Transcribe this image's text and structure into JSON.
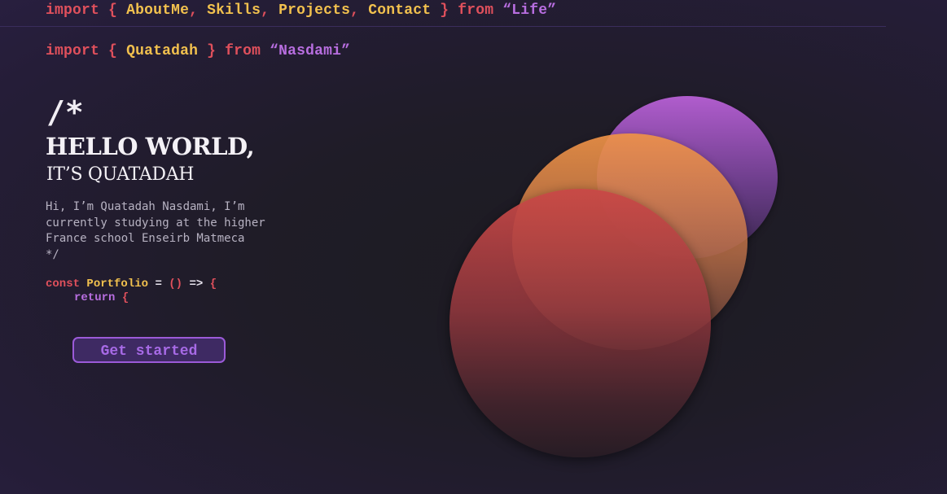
{
  "nav": {
    "keyword_import": "import",
    "brace_open": "{",
    "links": [
      "AboutMe",
      "Skills",
      "Projects",
      "Contact"
    ],
    "comma": ",",
    "brace_close": "}",
    "keyword_from": "from",
    "source": "“Life”"
  },
  "import_name": {
    "keyword_import": "import",
    "brace_open": "{",
    "name": "Quatadah",
    "brace_close": "}",
    "keyword_from": "from",
    "source": "“Nasdami”"
  },
  "hero": {
    "comment_open": "/*",
    "greeting": "HELLO WORLD,",
    "intro": "IT’S QUATADAH",
    "bio_line1": "Hi, I’m Quatadah Nasdami,  I’m",
    "bio_line2": "currently studying  at the higher",
    "bio_line3": "France school Enseirb Matmeca",
    "comment_close": "*/"
  },
  "code": {
    "const_kw": "const",
    "component": "Portfolio",
    "equals": "=",
    "parens": "()",
    "arrow": "=>",
    "brace": "{",
    "return_kw": "return",
    "return_brace": "{"
  },
  "cta": {
    "label": "Get started"
  },
  "colors": {
    "keyword": "#e0505c",
    "identifier": "#f2c14e",
    "string": "#b86ee0",
    "button_border": "#9b5ad8",
    "orb_purple": "#b860d6",
    "orb_orange": "#ee9246",
    "orb_red": "#c84846"
  }
}
